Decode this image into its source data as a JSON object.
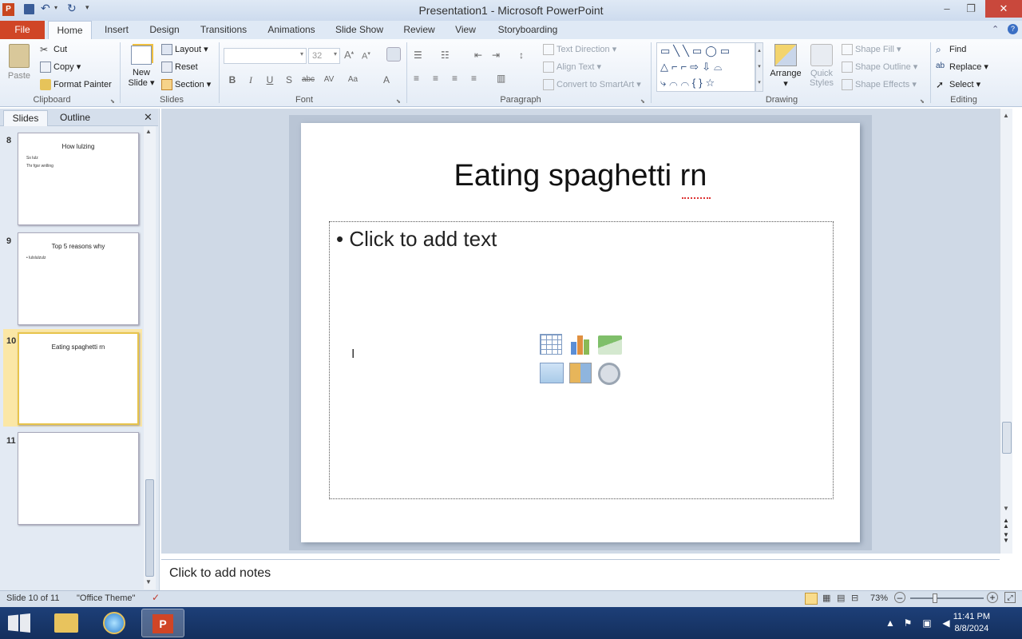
{
  "window": {
    "title": "Presentation1 - Microsoft PowerPoint"
  },
  "tabs": [
    "File",
    "Home",
    "Insert",
    "Design",
    "Transitions",
    "Animations",
    "Slide Show",
    "Review",
    "View",
    "Storyboarding"
  ],
  "clipboard": {
    "paste": "Paste",
    "cut": "Cut",
    "copy": "Copy",
    "format_painter": "Format Painter",
    "label": "Clipboard"
  },
  "slides_group": {
    "new_slide_1": "New",
    "new_slide_2": "Slide",
    "layout": "Layout",
    "reset": "Reset",
    "section": "Section",
    "label": "Slides"
  },
  "font": {
    "size": "32",
    "label": "Font"
  },
  "paragraph": {
    "text_direction": "Text Direction",
    "align_text": "Align Text",
    "convert_smartart": "Convert to SmartArt",
    "label": "Paragraph"
  },
  "drawing": {
    "arrange": "Arrange",
    "quick_styles_1": "Quick",
    "quick_styles_2": "Styles",
    "shape_fill": "Shape Fill",
    "shape_outline": "Shape Outline",
    "shape_effects": "Shape Effects",
    "label": "Drawing"
  },
  "editing": {
    "find": "Find",
    "replace": "Replace",
    "select": "Select",
    "label": "Editing"
  },
  "leftpane": {
    "tab_slides": "Slides",
    "tab_outline": "Outline",
    "thumbs": [
      {
        "num": "8",
        "title": "How lulzing",
        "lines": [
          "Ss lulz",
          "Thr fgsr wnlling"
        ]
      },
      {
        "num": "9",
        "title": "Top 5 reasons why",
        "lines": [
          "• lulslulzulz"
        ]
      },
      {
        "num": "10",
        "title": "Eating spaghetti rn",
        "lines": []
      },
      {
        "num": "11",
        "title": "",
        "lines": []
      }
    ]
  },
  "slide": {
    "title": "Eating spaghetti rn",
    "placeholder": "Click to add text"
  },
  "notes": {
    "placeholder": "Click to add notes"
  },
  "status": {
    "slide": "Slide 10 of 11",
    "theme": "\"Office Theme\"",
    "zoom": "73%"
  },
  "taskbar": {
    "time": "11:41 PM",
    "date": "8/8/2024"
  }
}
